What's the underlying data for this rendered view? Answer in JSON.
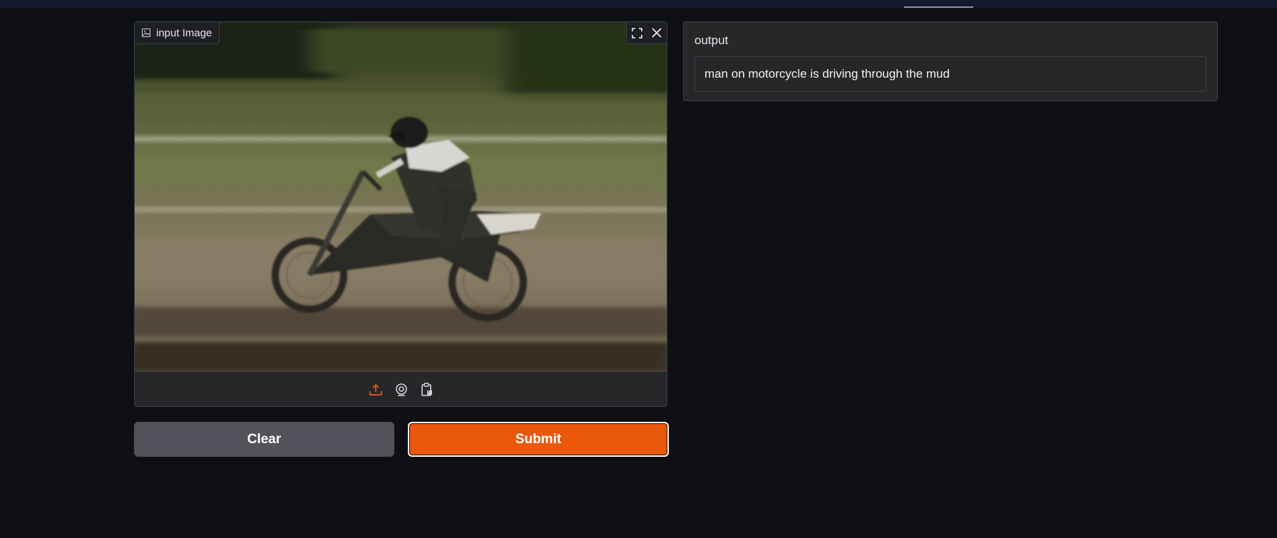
{
  "image_input": {
    "label": "input Image",
    "label_icon": "image-icon",
    "actions": [
      "fullscreen-icon",
      "close-icon"
    ],
    "sources": [
      "upload-icon",
      "webcam-icon",
      "clipboard-icon"
    ],
    "accent_color": "#ea580c"
  },
  "buttons": {
    "clear_label": "Clear",
    "submit_label": "Submit"
  },
  "output": {
    "label": "output",
    "value": "man on motorcycle is driving through the mud"
  },
  "colors": {
    "background": "#0f1014",
    "panel": "#27272a",
    "border": "#374151",
    "primary": "#ea580c",
    "secondary": "#52525b"
  }
}
